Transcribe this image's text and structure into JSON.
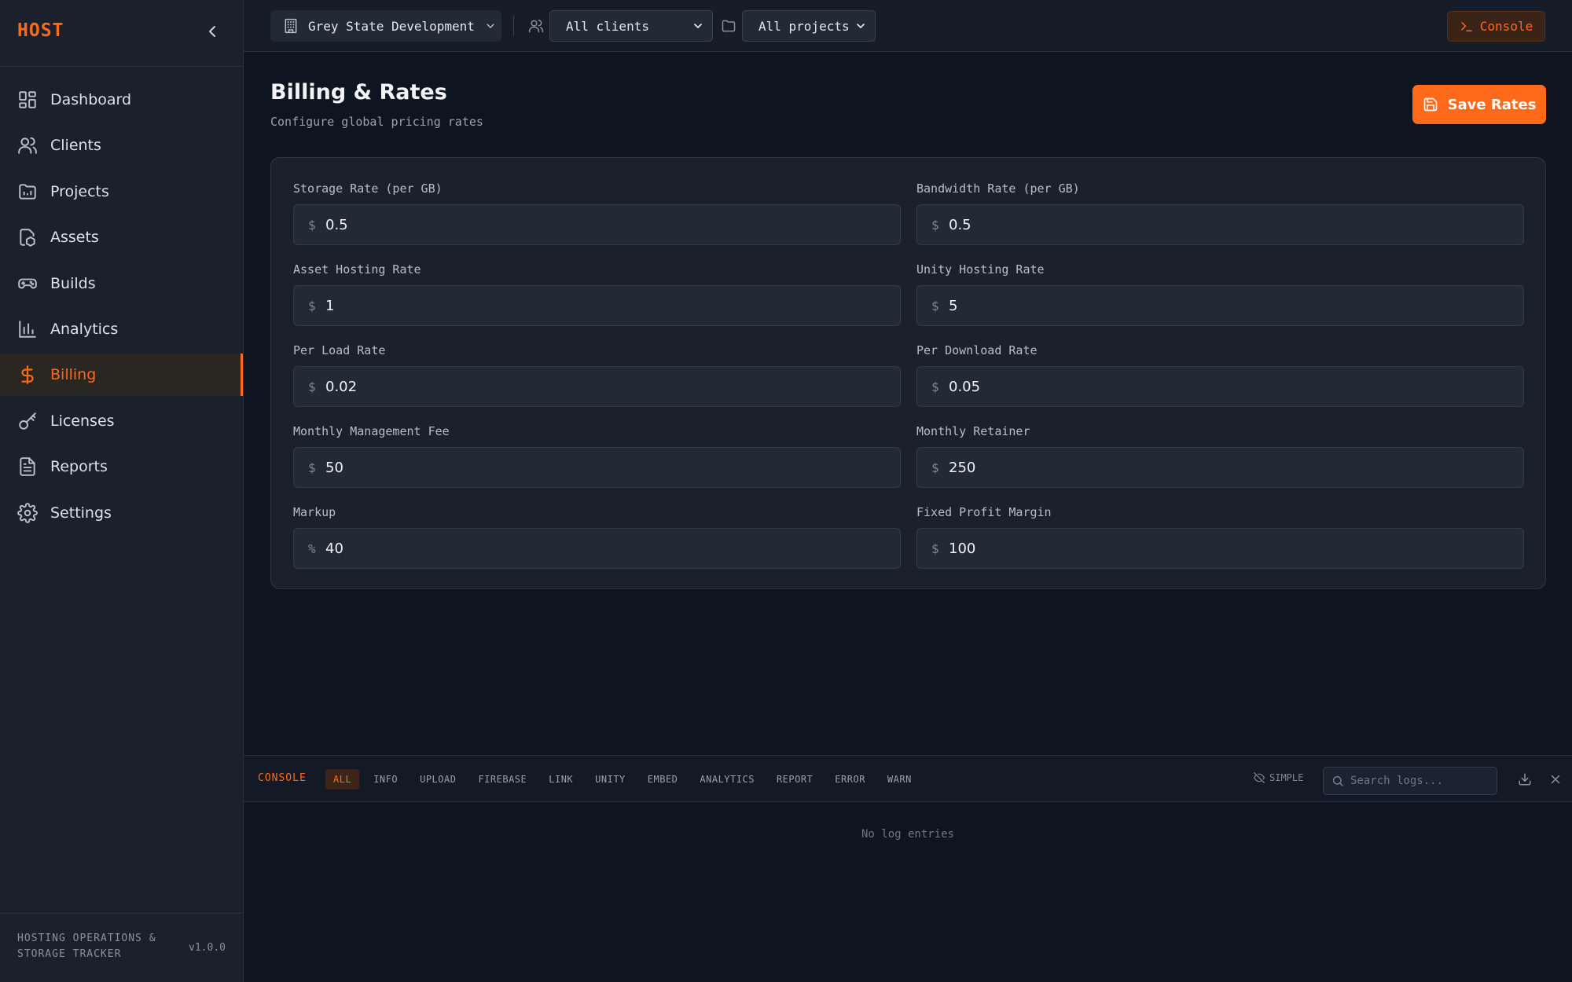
{
  "sidebar": {
    "brand": "HOST",
    "items": [
      {
        "label": "Dashboard",
        "icon": "dashboard-icon"
      },
      {
        "label": "Clients",
        "icon": "users-icon"
      },
      {
        "label": "Projects",
        "icon": "folder-icon"
      },
      {
        "label": "Assets",
        "icon": "assets-icon"
      },
      {
        "label": "Builds",
        "icon": "gamepad-icon"
      },
      {
        "label": "Analytics",
        "icon": "bar-chart-icon"
      },
      {
        "label": "Billing",
        "icon": "dollar-icon",
        "active": true
      },
      {
        "label": "Licenses",
        "icon": "key-icon"
      },
      {
        "label": "Reports",
        "icon": "file-text-icon"
      },
      {
        "label": "Settings",
        "icon": "gear-icon"
      }
    ],
    "footer_tagline": "HOSTING OPERATIONS & STORAGE TRACKER",
    "version": "v1.0.0"
  },
  "topbar": {
    "organization": "Grey State Development",
    "client_filter": "All clients",
    "project_filter": "All projects",
    "console_button": "Console"
  },
  "page": {
    "title": "Billing & Rates",
    "subtitle": "Configure global pricing rates",
    "save_button": "Save Rates"
  },
  "rates": [
    {
      "label": "Storage Rate (per GB)",
      "prefix": "$",
      "value": "0.5"
    },
    {
      "label": "Bandwidth Rate (per GB)",
      "prefix": "$",
      "value": "0.5"
    },
    {
      "label": "Asset Hosting Rate",
      "prefix": "$",
      "value": "1"
    },
    {
      "label": "Unity Hosting Rate",
      "prefix": "$",
      "value": "5"
    },
    {
      "label": "Per Load Rate",
      "prefix": "$",
      "value": "0.02"
    },
    {
      "label": "Per Download Rate",
      "prefix": "$",
      "value": "0.05"
    },
    {
      "label": "Monthly Management Fee",
      "prefix": "$",
      "value": "50"
    },
    {
      "label": "Monthly Retainer",
      "prefix": "$",
      "value": "250"
    },
    {
      "label": "Markup",
      "prefix": "%",
      "value": "40"
    },
    {
      "label": "Fixed Profit Margin",
      "prefix": "$",
      "value": "100"
    }
  ],
  "console": {
    "title": "CONSOLE",
    "filters": [
      "ALL",
      "INFO",
      "UPLOAD",
      "FIREBASE",
      "LINK",
      "UNITY",
      "EMBED",
      "ANALYTICS",
      "REPORT",
      "ERROR",
      "WARN"
    ],
    "active_filter": "ALL",
    "simple_label": "SIMPLE",
    "search_placeholder": "Search logs...",
    "empty_message": "No log entries"
  },
  "colors": {
    "accent": "#ff6a1a",
    "background": "#0f1520",
    "panel": "#1a212d"
  }
}
